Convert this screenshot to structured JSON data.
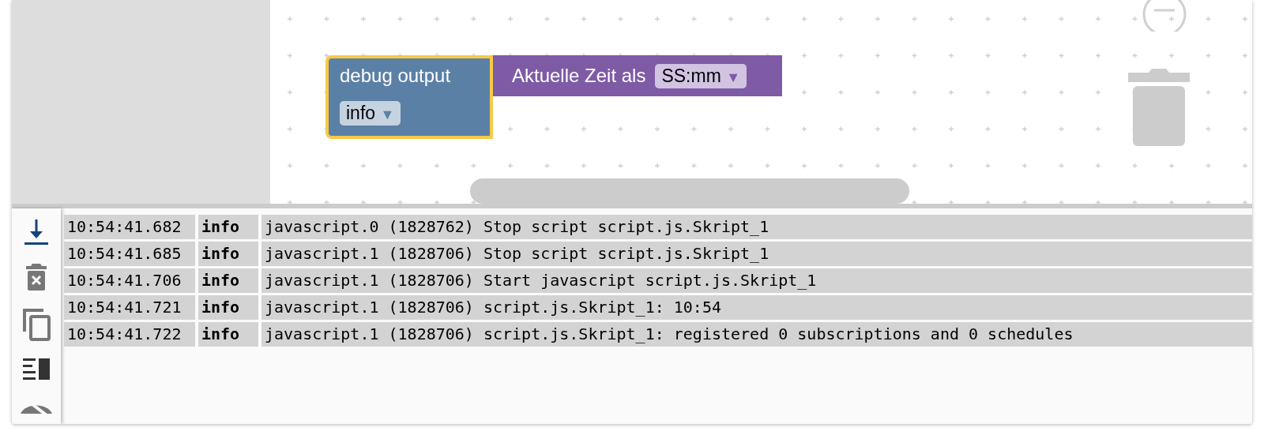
{
  "blocks": [
    {
      "kind": "statement",
      "label": "debug output",
      "dropdown": {
        "value": "info",
        "arrow": "▼"
      },
      "selected": true
    },
    {
      "kind": "value",
      "label": "Aktuelle Zeit als",
      "dropdown": {
        "value": "SS:mm",
        "arrow": "▼"
      },
      "selected": false
    }
  ],
  "log_toolbar": [
    {
      "kind": "scroll-down",
      "on": true
    },
    {
      "kind": "clear",
      "on": false
    },
    {
      "kind": "copy",
      "on": false
    },
    {
      "kind": "layout",
      "on": false
    },
    {
      "kind": "hide",
      "on": false
    }
  ],
  "log": [
    {
      "time": "10:54:41.682",
      "level": "info",
      "message": "javascript.0 (1828762) Stop script script.js.Skript_1"
    },
    {
      "time": "10:54:41.685",
      "level": "info",
      "message": "javascript.1 (1828706) Stop script script.js.Skript_1"
    },
    {
      "time": "10:54:41.706",
      "level": "info",
      "message": "javascript.1 (1828706) Start javascript script.js.Skript_1"
    },
    {
      "time": "10:54:41.721",
      "level": "info",
      "message": "javascript.1 (1828706) script.js.Skript_1: 10:54"
    },
    {
      "time": "10:54:41.722",
      "level": "info",
      "message": "javascript.1 (1828706) script.js.Skript_1: registered 0 subscriptions and 0 schedules"
    }
  ]
}
